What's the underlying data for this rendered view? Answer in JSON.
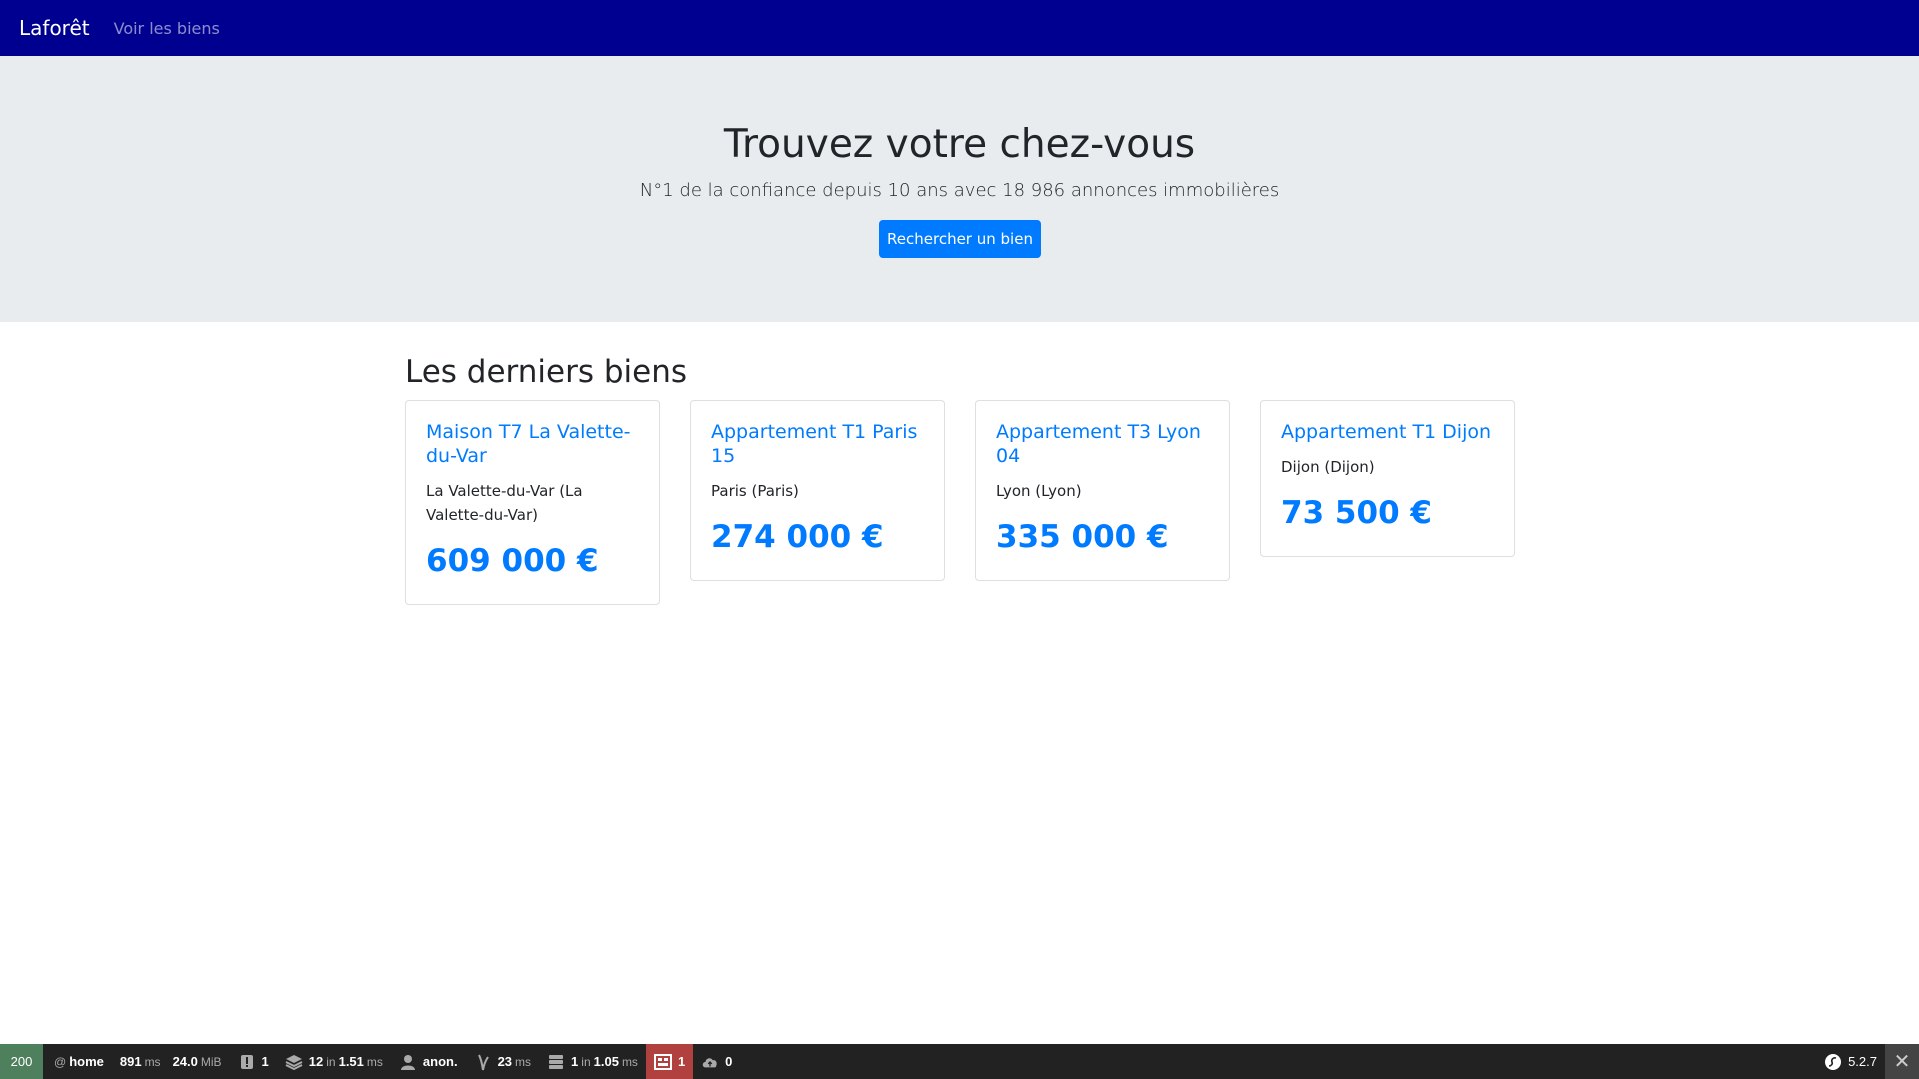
{
  "navbar": {
    "brand": "Laforêt",
    "links": [
      "Voir les biens"
    ]
  },
  "hero": {
    "title": "Trouvez votre chez-vous",
    "subtitle": "N°1 de la confiance depuis 10 ans avec 18 986 annonces immobilières",
    "button": "Rechercher un bien"
  },
  "section": {
    "title": "Les derniers biens"
  },
  "cards": [
    {
      "title": "Maison T7 La Valette-du-Var",
      "location": "La Valette-du-Var (La Valette-du-Var)",
      "price": "609 000 €"
    },
    {
      "title": "Appartement T1 Paris 15",
      "location": "Paris (Paris)",
      "price": "274 000 €"
    },
    {
      "title": "Appartement T3 Lyon 04",
      "location": "Lyon (Lyon)",
      "price": "335 000 €"
    },
    {
      "title": "Appartement T1 Dijon",
      "location": "Dijon (Dijon)",
      "price": "73 500 €"
    }
  ],
  "toolbar": {
    "status": "200",
    "route_prefix": "@",
    "route": "home",
    "time_value": "891",
    "time_unit": "ms",
    "memory_value": "24.0",
    "memory_unit": "MiB",
    "logs": "1",
    "cache_count": "12",
    "cache_in": "in",
    "cache_time": "1.51",
    "cache_unit": "ms",
    "user": "anon.",
    "twig_time": "23",
    "twig_unit": "ms",
    "db_count": "1",
    "db_in": "in",
    "db_time": "1.05",
    "db_unit": "ms",
    "forms": "1",
    "http_client": "0",
    "version": "5.2.7",
    "colors": {
      "status_ok": "#4f805d",
      "error": "#b0413e",
      "bg": "#222222"
    }
  },
  "colors": {
    "navbar": "#000090",
    "primary": "#007bff",
    "jumbotron": "#e9ecef"
  }
}
